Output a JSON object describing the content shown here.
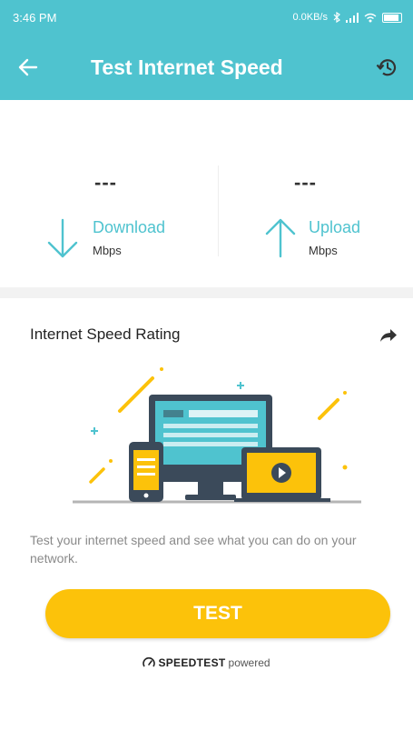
{
  "status_bar": {
    "time": "3:46 PM",
    "network_speed": "0.0KB/s"
  },
  "app_bar": {
    "title": "Test Internet Speed",
    "back_icon": "arrow-left-icon",
    "history_icon": "history-icon"
  },
  "results": {
    "download": {
      "value": "---",
      "label": "Download",
      "unit": "Mbps",
      "icon": "arrow-down-icon"
    },
    "upload": {
      "value": "---",
      "label": "Upload",
      "unit": "Mbps",
      "icon": "arrow-up-icon"
    }
  },
  "rating": {
    "title": "Internet Speed Rating",
    "share_icon": "share-icon",
    "description": "Test your internet speed and see what you can do on your network.",
    "test_button": "TEST"
  },
  "footer": {
    "brand": "SPEEDTEST",
    "suffix": "powered"
  },
  "colors": {
    "accent": "#4fc3cf",
    "button": "#fcc20a",
    "text": "#333333",
    "muted": "#8a8a8a"
  }
}
